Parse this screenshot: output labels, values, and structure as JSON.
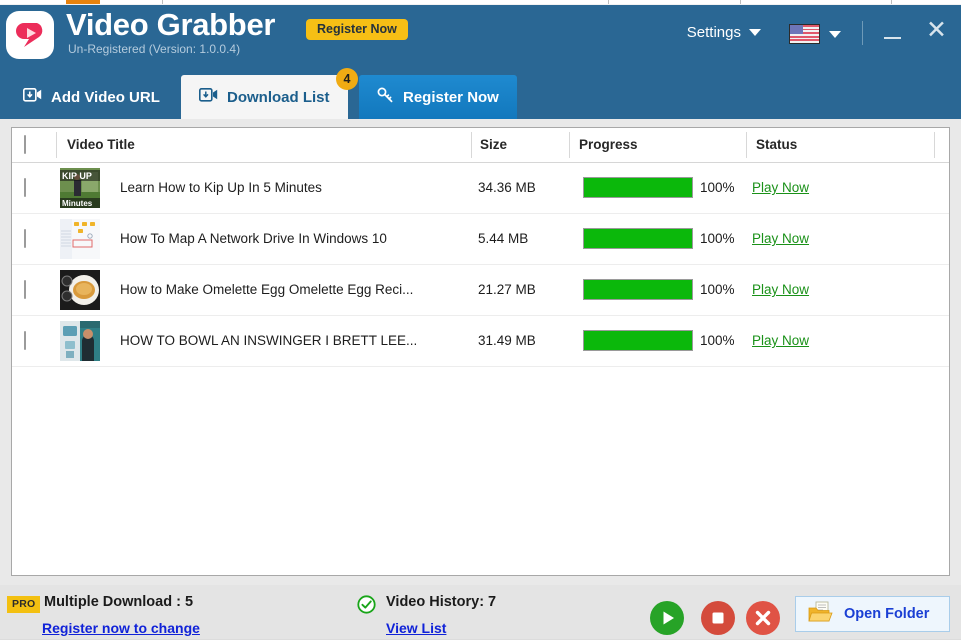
{
  "header": {
    "logo_icon": "video-grabber-logo",
    "title": "Video Grabber",
    "subtitle": "Un-Registered (Version: 1.0.0.4)",
    "register_badge": "Register Now",
    "settings_label": "Settings",
    "settings_caret_icon": "chevron-down-icon",
    "flag_icon": "us-flag-icon",
    "flag_caret_icon": "chevron-down-icon",
    "minimize_icon": "minimize-icon",
    "close_icon": "close-icon",
    "accent_blue": "#2a6794",
    "badge_gold": "#f6bf15"
  },
  "tabs": [
    {
      "label": "Add Video URL",
      "icon": "video-camera-icon",
      "active": false,
      "badge": ""
    },
    {
      "label": "Download List",
      "icon": "video-camera-icon",
      "active": true,
      "badge": "4"
    },
    {
      "label": "Register Now",
      "icon": "key-icon",
      "active": false,
      "badge": ""
    }
  ],
  "table": {
    "select_all_checkbox": "unchecked",
    "columns": [
      "Video Title",
      "Size",
      "Progress",
      "Status"
    ],
    "rows": [
      {
        "checkbox": "unchecked",
        "thumbnail": "kip-up-thumbnail",
        "title": "Learn How to Kip Up In 5 Minutes",
        "size": "34.36 MB",
        "progress_pct": 100,
        "progress_label": "100%",
        "status": "Play Now"
      },
      {
        "checkbox": "unchecked",
        "thumbnail": "network-drive-thumbnail",
        "title": "How To Map A Network Drive In Windows 10",
        "size": "5.44 MB",
        "progress_pct": 100,
        "progress_label": "100%",
        "status": "Play Now"
      },
      {
        "checkbox": "unchecked",
        "thumbnail": "omelette-thumbnail",
        "title": "How to Make Omelette  Egg Omelette  Egg Reci...",
        "size": "21.27 MB",
        "progress_pct": 100,
        "progress_label": "100%",
        "status": "Play Now"
      },
      {
        "checkbox": "unchecked",
        "thumbnail": "bowling-thumbnail",
        "title": "HOW TO BOWL AN INSWINGER I BRETT LEE...",
        "size": "31.49 MB",
        "progress_pct": 100,
        "progress_label": "100%",
        "status": "Play Now"
      }
    ],
    "progress_green": "#0bb80b",
    "link_green": "#1a9118"
  },
  "footer": {
    "pro_badge": "PRO",
    "multiple_download": "Multiple Download : 5",
    "register_link": "Register now to change",
    "history_icon": "check-circle-icon",
    "video_history": "Video History: 7",
    "view_list_link": "View List",
    "start_icon": "play-icon",
    "stop_icon": "stop-icon",
    "cancel_icon": "close-circle-icon",
    "folder_icon": "open-folder-icon",
    "open_folder_label": "Open Folder",
    "link_blue": "#1022d8"
  }
}
